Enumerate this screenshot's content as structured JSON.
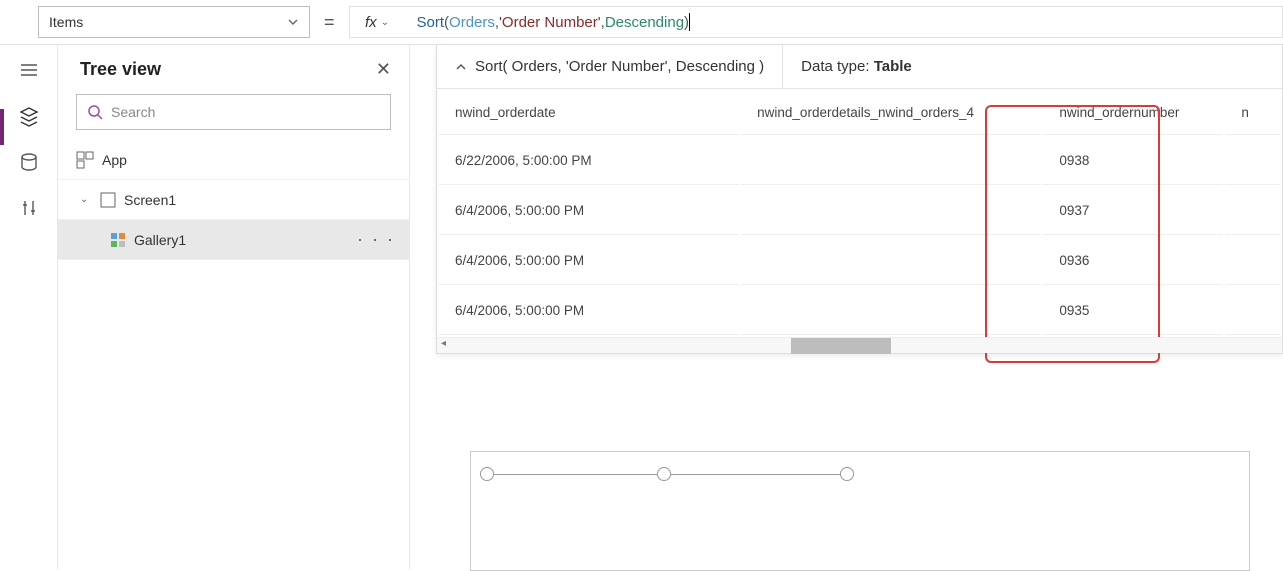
{
  "topbar": {
    "property": "Items",
    "fx_label": "fx",
    "formula_tokens": {
      "fn": "Sort",
      "lp": "( ",
      "arg1": "Orders",
      "c1": ", ",
      "arg2": "'Order Number'",
      "c2": ", ",
      "arg3": "Descending",
      "rp": " )"
    }
  },
  "panel": {
    "title": "Tree view",
    "search_placeholder": "Search",
    "app_label": "App",
    "screen_label": "Screen1",
    "gallery_label": "Gallery1",
    "actions": "· · ·"
  },
  "result": {
    "summary": "Sort( Orders, 'Order Number', Descending )",
    "datatype_label": "Data type:",
    "datatype_value": "Table",
    "columns": {
      "a": "nwind_orderdate",
      "b": "nwind_orderdetails_nwind_orders_4",
      "c": "nwind_ordernumber",
      "d": "n"
    },
    "rows": [
      {
        "a": "6/22/2006, 5:00:00 PM",
        "b": "",
        "c": "0938"
      },
      {
        "a": "6/4/2006, 5:00:00 PM",
        "b": "",
        "c": "0937"
      },
      {
        "a": "6/4/2006, 5:00:00 PM",
        "b": "",
        "c": "0936"
      },
      {
        "a": "6/4/2006, 5:00:00 PM",
        "b": "",
        "c": "0935"
      }
    ]
  }
}
